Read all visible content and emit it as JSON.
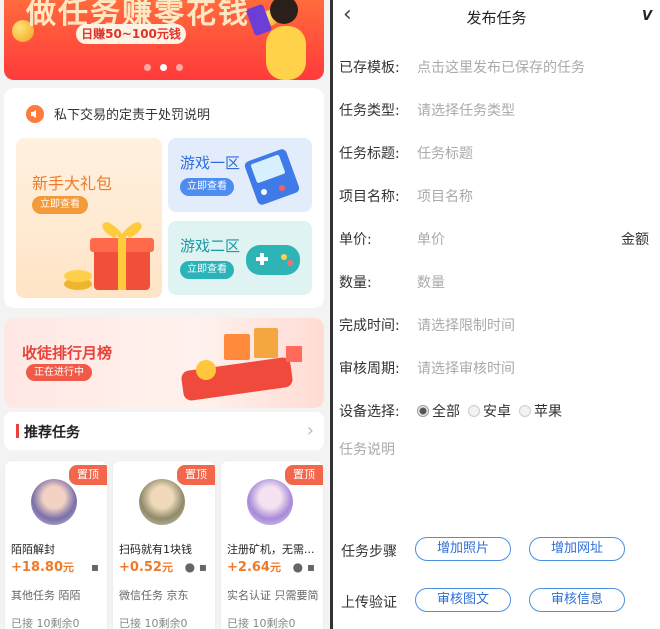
{
  "left": {
    "banner": {
      "headline": "做任务赚零花钱",
      "pill": "日赚50~100元钱"
    },
    "notice": "私下交易的定责于处罚说明",
    "gift": {
      "title": "新手大礼包",
      "button": "立即查看"
    },
    "zone1": {
      "title": "游戏一区",
      "button": "立即查看"
    },
    "zone2": {
      "title": "游戏二区",
      "button": "立即查看"
    },
    "rank": {
      "title": "收徒排行月榜",
      "button": "正在进行中"
    },
    "recommend": {
      "title": "推荐任务"
    },
    "cards": [
      {
        "badge": "置顶",
        "name": "陌陌解封",
        "price": "+18.80",
        "unit": "元",
        "os": "android",
        "tags": "其他任务  陌陌",
        "remain": "已接 10剩余0"
      },
      {
        "badge": "置顶",
        "name": "扫码就有1块钱",
        "price": "+0.52",
        "unit": "元",
        "os": "apple-android",
        "tags": "微信任务  京东",
        "remain": "已接 10剩余0"
      },
      {
        "badge": "置顶",
        "name": "注册矿机，无需...",
        "price": "+2.64",
        "unit": "元",
        "os": "apple-android",
        "tags": "实名认证  只需要简",
        "remain": "已接 10剩余0"
      }
    ]
  },
  "right": {
    "nav": {
      "back": "‹",
      "title": "发布任务",
      "logo": "V"
    },
    "fields": [
      {
        "label": "已存模板:",
        "placeholder": "点击这里发布已保存的任务"
      },
      {
        "label": "任务类型:",
        "placeholder": "请选择任务类型"
      },
      {
        "label": "任务标题:",
        "placeholder": "任务标题"
      },
      {
        "label": "项目名称:",
        "placeholder": "项目名称"
      },
      {
        "label": "单价:",
        "placeholder": "单价",
        "unit": "金额"
      },
      {
        "label": "数量:",
        "placeholder": "数量"
      },
      {
        "label": "完成时间:",
        "placeholder": "请选择限制时间"
      },
      {
        "label": "审核周期:",
        "placeholder": "请选择审核时间"
      }
    ],
    "device": {
      "label": "设备选择:",
      "options": [
        "全部",
        "安卓",
        "苹果"
      ],
      "selected": "全部"
    },
    "description_placeholder": "任务说明",
    "steps": {
      "label": "任务步骤",
      "add_photo": "增加照片",
      "add_url": "增加网址"
    },
    "verify": {
      "label": "上传验证",
      "review_text": "审核图文",
      "review_info": "审核信息"
    }
  }
}
